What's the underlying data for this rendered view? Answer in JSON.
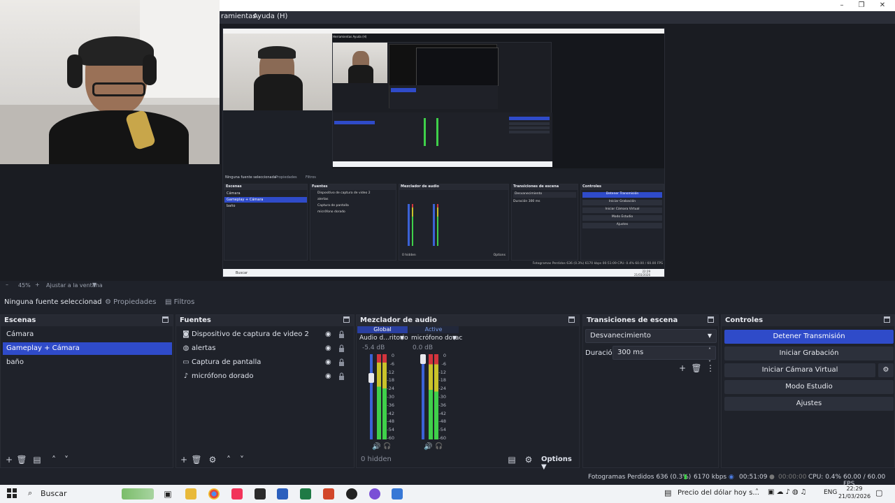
{
  "menu": {
    "items": [
      "ramientas",
      "Ayuda (H)"
    ]
  },
  "window_controls": {
    "minimize": "–",
    "restore": "❐",
    "close": "✕"
  },
  "preview": {
    "nested": {
      "menu": "Herramientas   Ayuda (H)",
      "sources_bar": "Ninguna fuente seleccionada",
      "props": "Propiedades",
      "filters": "Filtros",
      "scenes_title": "Escenas",
      "scenes": [
        "Cámara",
        "Gameplay + Cámara",
        "baño"
      ],
      "sources_title": "Fuentes",
      "sources": [
        "Dispositivo de captura de video 2",
        "alertas",
        "Captura de pantalla",
        "micrófono dorado"
      ],
      "mixer_title": "Mezclador de audio",
      "transitions_title": "Transiciones de escena",
      "transition": "Desvanecimiento",
      "duration_label": "Duración",
      "duration": "300 ms",
      "controls_title": "Controles",
      "controls": [
        "Detener Transmisión",
        "Iniciar Grabación",
        "Iniciar Cámara Virtual",
        "Modo Estudio",
        "Ajustes"
      ],
      "hidden": "0 hidden",
      "options": "Options",
      "status": "Fotogramas Perdidos 636 (0.3%)   6170 kbps   00:51:09   CPU: 0.4%   60.00 / 60.00 FPS",
      "search": "Buscar",
      "clock": "22:29",
      "date": "21/03/2026"
    }
  },
  "zoom": {
    "minus": "–",
    "value": "45%",
    "plus": "+",
    "fit": "Ajustar a la ventana"
  },
  "props_bar": {
    "no_source": "Ninguna fuente seleccionad",
    "properties": "Propiedades",
    "filters": "Filtros"
  },
  "scenes": {
    "title": "Escenas",
    "items": [
      "Cámara",
      "Gameplay + Cámara",
      "baño"
    ],
    "selected": 1
  },
  "sources": {
    "title": "Fuentes",
    "items": [
      {
        "label": "Dispositivo de captura de video 2",
        "icon": "camera-icon"
      },
      {
        "label": "alertas",
        "icon": "globe-icon"
      },
      {
        "label": "Captura de pantalla",
        "icon": "monitor-icon"
      },
      {
        "label": "micrófono dorado",
        "icon": "microphone-icon"
      }
    ]
  },
  "mixer": {
    "title": "Mezclador de audio",
    "global_label": "Global",
    "active_label": "Active",
    "channels": [
      {
        "name": "Audio d...ritorio",
        "db": "-5.4 dB",
        "volume": 0.73
      },
      {
        "name": "micrófono dorac",
        "db": "0.0 dB",
        "volume": 1.0
      }
    ],
    "scale": [
      "0",
      "-6",
      "-12",
      "-18",
      "-24",
      "-30",
      "-36",
      "-42",
      "-48",
      "-54",
      "-60"
    ],
    "hidden": "0 hidden",
    "options": "Options"
  },
  "transitions": {
    "title": "Transiciones de escena",
    "selected": "Desvanecimiento",
    "duration_label": "Duración",
    "duration": "300 ms"
  },
  "controls": {
    "title": "Controles",
    "stop_stream": "Detener Transmisión",
    "start_record": "Iniciar Grabación",
    "start_virtual_cam": "Iniciar Cámara Virtual",
    "studio_mode": "Modo Estudio",
    "settings": "Ajustes"
  },
  "status": {
    "dropped_frames": "Fotogramas Perdidos 636 (0.3%)",
    "bitrate": "6170 kbps",
    "stream_time": "00:51:09",
    "record_time": "00:00:00",
    "cpu": "CPU: 0.4%",
    "fps": "60.00 / 60.00 FPS"
  },
  "taskbar": {
    "search": "Buscar",
    "news": "Precio del dólar hoy s...",
    "lang": "ENG",
    "time": "22:29",
    "date": "21/03/2026"
  },
  "colors": {
    "accent": "#2f4bc9",
    "meter_green": "#3fd04a",
    "meter_yellow": "#c9c22a",
    "meter_red": "#d2343d"
  }
}
